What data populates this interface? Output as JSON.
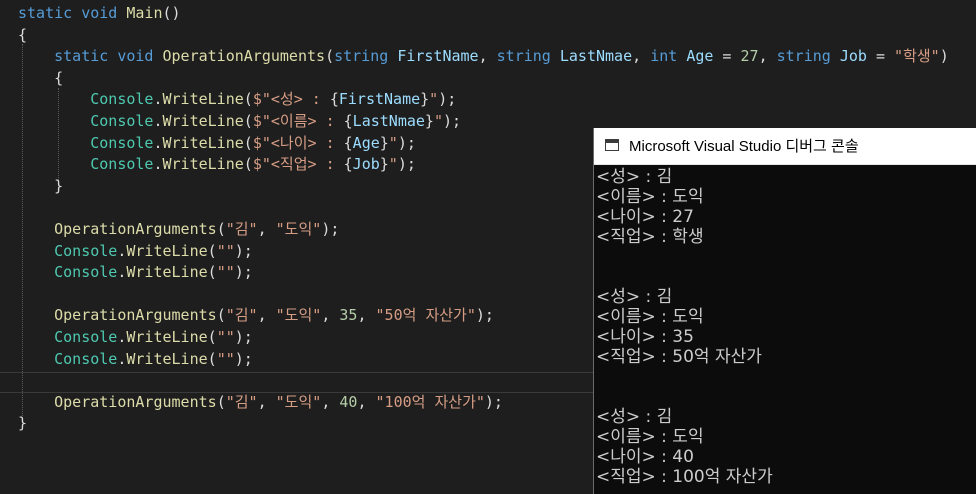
{
  "code": {
    "lines": [
      [
        [
          "kw",
          "static"
        ],
        [
          "pn",
          " "
        ],
        [
          "kw",
          "void"
        ],
        [
          "pn",
          " "
        ],
        [
          "fn",
          "Main"
        ],
        [
          "pn",
          "()"
        ]
      ],
      [
        [
          "pn",
          "{"
        ]
      ],
      [
        [
          "pn",
          "    "
        ],
        [
          "kw",
          "static"
        ],
        [
          "pn",
          " "
        ],
        [
          "kw",
          "void"
        ],
        [
          "pn",
          " "
        ],
        [
          "fn",
          "OperationArguments"
        ],
        [
          "pn",
          "("
        ],
        [
          "kw",
          "string"
        ],
        [
          "pn",
          " "
        ],
        [
          "id",
          "FirstName"
        ],
        [
          "pn",
          ", "
        ],
        [
          "kw",
          "string"
        ],
        [
          "pn",
          " "
        ],
        [
          "id",
          "LastNmae"
        ],
        [
          "pn",
          ", "
        ],
        [
          "kw",
          "int"
        ],
        [
          "pn",
          " "
        ],
        [
          "id",
          "Age"
        ],
        [
          "pn",
          " = "
        ],
        [
          "nm",
          "27"
        ],
        [
          "pn",
          ", "
        ],
        [
          "kw",
          "string"
        ],
        [
          "pn",
          " "
        ],
        [
          "id",
          "Job"
        ],
        [
          "pn",
          " = "
        ],
        [
          "st",
          "\"학생\""
        ],
        [
          "pn",
          ")"
        ]
      ],
      [
        [
          "pn",
          "    {"
        ]
      ],
      [
        [
          "pn",
          "        "
        ],
        [
          "ty",
          "Console"
        ],
        [
          "pn",
          "."
        ],
        [
          "fn",
          "WriteLine"
        ],
        [
          "pn",
          "("
        ],
        [
          "st",
          "$\"<성> : "
        ],
        [
          "pn",
          "{"
        ],
        [
          "id",
          "FirstName"
        ],
        [
          "pn",
          "}"
        ],
        [
          "st",
          "\""
        ],
        [
          "pn",
          ");"
        ]
      ],
      [
        [
          "pn",
          "        "
        ],
        [
          "ty",
          "Console"
        ],
        [
          "pn",
          "."
        ],
        [
          "fn",
          "WriteLine"
        ],
        [
          "pn",
          "("
        ],
        [
          "st",
          "$\"<이름> : "
        ],
        [
          "pn",
          "{"
        ],
        [
          "id",
          "LastNmae"
        ],
        [
          "pn",
          "}"
        ],
        [
          "st",
          "\""
        ],
        [
          "pn",
          ");"
        ]
      ],
      [
        [
          "pn",
          "        "
        ],
        [
          "ty",
          "Console"
        ],
        [
          "pn",
          "."
        ],
        [
          "fn",
          "WriteLine"
        ],
        [
          "pn",
          "("
        ],
        [
          "st",
          "$\"<나이> : "
        ],
        [
          "pn",
          "{"
        ],
        [
          "id",
          "Age"
        ],
        [
          "pn",
          "}"
        ],
        [
          "st",
          "\""
        ],
        [
          "pn",
          ");"
        ]
      ],
      [
        [
          "pn",
          "        "
        ],
        [
          "ty",
          "Console"
        ],
        [
          "pn",
          "."
        ],
        [
          "fn",
          "WriteLine"
        ],
        [
          "pn",
          "("
        ],
        [
          "st",
          "$\"<직업> : "
        ],
        [
          "pn",
          "{"
        ],
        [
          "id",
          "Job"
        ],
        [
          "pn",
          "}"
        ],
        [
          "st",
          "\""
        ],
        [
          "pn",
          ");"
        ]
      ],
      [
        [
          "pn",
          "    }"
        ]
      ],
      [],
      [
        [
          "pn",
          "    "
        ],
        [
          "fn",
          "OperationArguments"
        ],
        [
          "pn",
          "("
        ],
        [
          "st",
          "\"김\""
        ],
        [
          "pn",
          ", "
        ],
        [
          "st",
          "\"도익\""
        ],
        [
          "pn",
          ");"
        ]
      ],
      [
        [
          "pn",
          "    "
        ],
        [
          "ty",
          "Console"
        ],
        [
          "pn",
          "."
        ],
        [
          "fn",
          "WriteLine"
        ],
        [
          "pn",
          "("
        ],
        [
          "st",
          "\"\""
        ],
        [
          "pn",
          ");"
        ]
      ],
      [
        [
          "pn",
          "    "
        ],
        [
          "ty",
          "Console"
        ],
        [
          "pn",
          "."
        ],
        [
          "fn",
          "WriteLine"
        ],
        [
          "pn",
          "("
        ],
        [
          "st",
          "\"\""
        ],
        [
          "pn",
          ");"
        ]
      ],
      [],
      [
        [
          "pn",
          "    "
        ],
        [
          "fn",
          "OperationArguments"
        ],
        [
          "pn",
          "("
        ],
        [
          "st",
          "\"김\""
        ],
        [
          "pn",
          ", "
        ],
        [
          "st",
          "\"도익\""
        ],
        [
          "pn",
          ", "
        ],
        [
          "nm",
          "35"
        ],
        [
          "pn",
          ", "
        ],
        [
          "st",
          "\"50억 자산가\""
        ],
        [
          "pn",
          ");"
        ]
      ],
      [
        [
          "pn",
          "    "
        ],
        [
          "ty",
          "Console"
        ],
        [
          "pn",
          "."
        ],
        [
          "fn",
          "WriteLine"
        ],
        [
          "pn",
          "("
        ],
        [
          "st",
          "\"\""
        ],
        [
          "pn",
          ");"
        ]
      ],
      [
        [
          "pn",
          "    "
        ],
        [
          "ty",
          "Console"
        ],
        [
          "pn",
          "."
        ],
        [
          "fn",
          "WriteLine"
        ],
        [
          "pn",
          "("
        ],
        [
          "st",
          "\"\""
        ],
        [
          "pn",
          ");"
        ]
      ],
      [],
      [
        [
          "pn",
          "    "
        ],
        [
          "fn",
          "OperationArguments"
        ],
        [
          "pn",
          "("
        ],
        [
          "st",
          "\"김\""
        ],
        [
          "pn",
          ", "
        ],
        [
          "st",
          "\"도익\""
        ],
        [
          "pn",
          ", "
        ],
        [
          "nm",
          "40"
        ],
        [
          "pn",
          ", "
        ],
        [
          "st",
          "\"100억 자산가\""
        ],
        [
          "pn",
          ");"
        ]
      ],
      [
        [
          "pn",
          "}"
        ]
      ]
    ]
  },
  "console": {
    "title": "Microsoft Visual Studio 디버그 콘솔",
    "lines": [
      "<성> : 김",
      "<이름> : 도익",
      "<나이> : 27",
      "<직업> : 학생",
      "",
      "",
      "<성> : 김",
      "<이름> : 도익",
      "<나이> : 35",
      "<직업> : 50억 자산가",
      "",
      "",
      "<성> : 김",
      "<이름> : 도익",
      "<나이> : 40",
      "<직업> : 100억 자산가"
    ]
  }
}
